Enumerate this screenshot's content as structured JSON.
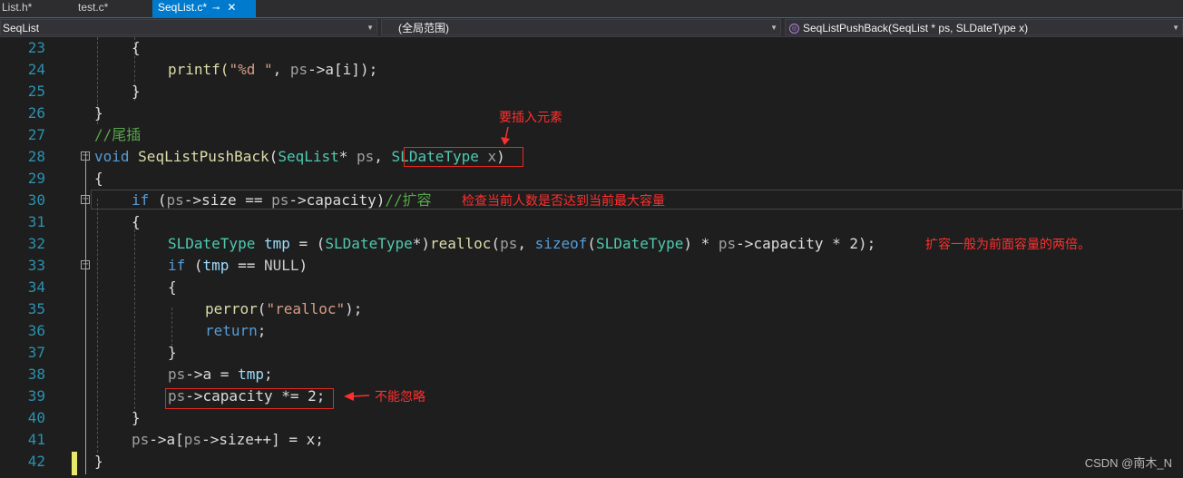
{
  "tabs": [
    {
      "label": "List.h*"
    },
    {
      "label": "test.c*"
    },
    {
      "label": "SeqList.c*",
      "pin": "⊸",
      "close": "✕"
    }
  ],
  "nav": {
    "project": "SeqList",
    "scope": "(全局范围)",
    "member": "SeqListPushBack(SeqList * ps, SLDateType x)",
    "member_icon": "function-icon"
  },
  "lines": {
    "l23": {
      "num": "23",
      "t1": "{"
    },
    "l24": {
      "num": "24",
      "t1": "printf(",
      "t2": "\"%d \"",
      "t3": ", ",
      "t4": "ps",
      "t5": "->",
      "t6": "a[i]);"
    },
    "l25": {
      "num": "25",
      "t1": "}"
    },
    "l26": {
      "num": "26",
      "t1": "}"
    },
    "l27": {
      "num": "27",
      "t1": "//尾插"
    },
    "l28": {
      "num": "28",
      "t1": "void",
      "t2": " ",
      "t3": "SeqListPushBack",
      "t4": "(",
      "t5": "SeqList",
      "t6": "* ",
      "t7": "ps",
      "t8": ", ",
      "t9": "SLDateType",
      "t10": " x",
      "t11": ")"
    },
    "l29": {
      "num": "29",
      "t1": "{"
    },
    "l30": {
      "num": "30",
      "t1": "if",
      "t2": " (",
      "t3": "ps",
      "t4": "->",
      "t5": "size",
      "t6": " == ",
      "t7": "ps",
      "t8": "->",
      "t9": "capacity",
      "t10": ")",
      "t11": "//扩容"
    },
    "l31": {
      "num": "31",
      "t1": "{"
    },
    "l32": {
      "num": "32",
      "t1": "SLDateType",
      "t2": " ",
      "t3": "tmp",
      "t4": " = (",
      "t5": "SLDateType",
      "t6": "*)",
      "t7": "realloc",
      "t8": "(",
      "t9": "ps",
      "t10": ", ",
      "t11": "sizeof",
      "t12": "(",
      "t13": "SLDateType",
      "t14": ") * ",
      "t15": "ps",
      "t16": "->",
      "t17": "capacity",
      "t18": " * 2);"
    },
    "l33": {
      "num": "33",
      "t1": "if",
      "t2": " (",
      "t3": "tmp",
      "t4": " == ",
      "t5": "NULL",
      "t6": ")"
    },
    "l34": {
      "num": "34",
      "t1": "{"
    },
    "l35": {
      "num": "35",
      "t1": "perror",
      "t2": "(",
      "t3": "\"realloc\"",
      "t4": ");"
    },
    "l36": {
      "num": "36",
      "t1": "return",
      "t2": ";"
    },
    "l37": {
      "num": "37",
      "t1": "}"
    },
    "l38": {
      "num": "38",
      "t1": "ps",
      "t2": "->",
      "t3": "a",
      "t4": " = ",
      "t5": "tmp",
      "t6": ";"
    },
    "l39": {
      "num": "39",
      "t1": "ps",
      "t2": "->",
      "t3": "capacity",
      "t4": " *= 2;"
    },
    "l40": {
      "num": "40",
      "t1": "}"
    },
    "l41": {
      "num": "41",
      "t1": "ps",
      "t2": "->",
      "t3": "a[",
      "t4": "ps",
      "t5": "->",
      "t6": "size",
      "t7": "++] = x;"
    },
    "l42": {
      "num": "42",
      "t1": "}"
    }
  },
  "annotations": {
    "insert_element": "要插入元素",
    "check_capacity": "检查当前人数是否达到当前最大容量",
    "double_capacity": "扩容一般为前面容量的两倍。",
    "cannot_ignore": "不能忽略"
  },
  "watermark": "CSDN @南木_N",
  "colors": {
    "annotation": "#ff2f2f",
    "tab_active": "#007acc",
    "line_number": "#2b91af"
  }
}
